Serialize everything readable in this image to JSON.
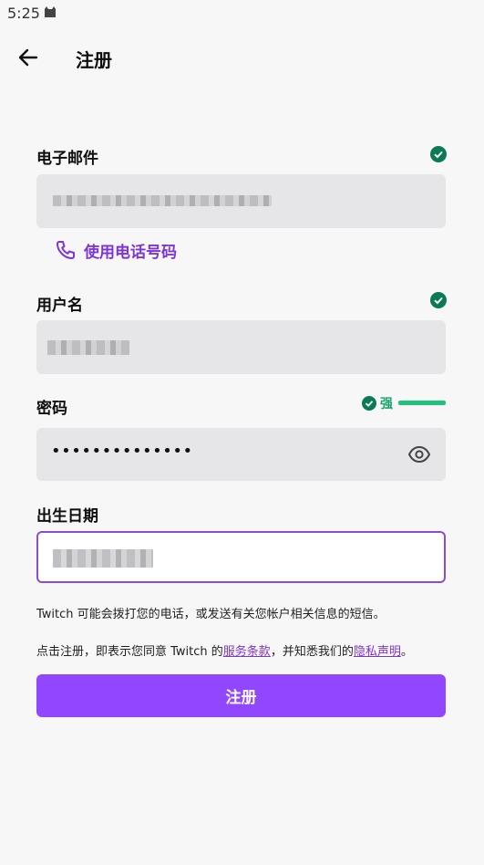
{
  "status_bar": {
    "time": "5:25"
  },
  "header": {
    "title": "注册"
  },
  "form": {
    "email": {
      "label": "电子邮件"
    },
    "phone_link": "使用电话号码",
    "username": {
      "label": "用户名"
    },
    "password": {
      "label": "密码",
      "value": "••••••••••••••",
      "strength": "强"
    },
    "birthdate": {
      "label": "出生日期"
    }
  },
  "notice": {
    "call_notice": "Twitch 可能会拨打您的电话，或发送有关您帐户相关信息的短信。",
    "terms_prefix": "点击注册，即表示您同意 Twitch 的",
    "terms_link": "服务条款",
    "terms_middle": "，并知悉我们的",
    "privacy_link": "隐私声明",
    "terms_suffix": "。"
  },
  "submit_label": "注册",
  "colors": {
    "accent": "#9147ff",
    "link": "#7d35d4",
    "success": "#1aa36b"
  }
}
